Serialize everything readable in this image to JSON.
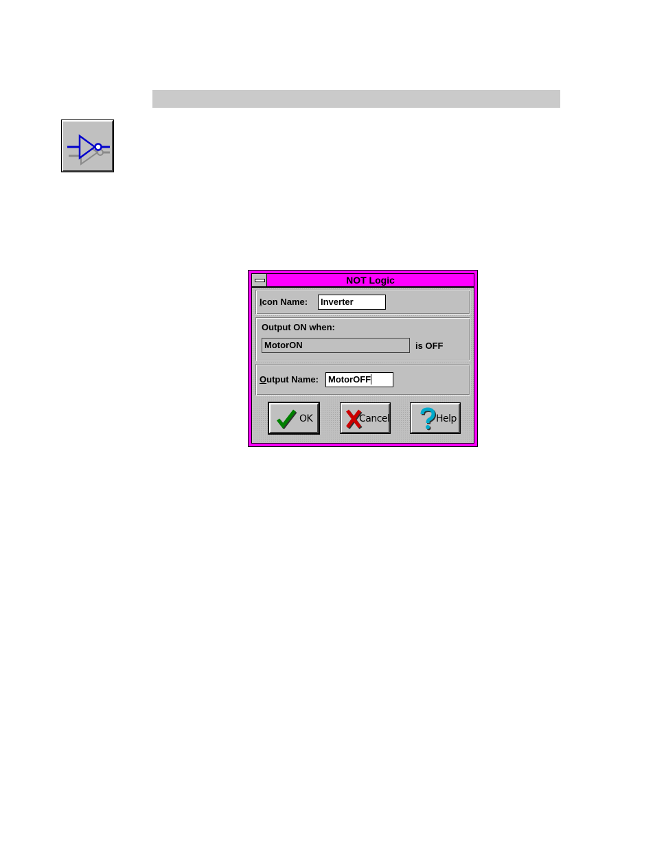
{
  "dialog": {
    "title": "NOT Logic",
    "icon_name_label_accel": "I",
    "icon_name_label_rest": "con Name:",
    "icon_name_value": "Inverter",
    "output_on_label": "Output ON when:",
    "input_value": "MotorON",
    "is_off_text": "is OFF",
    "output_name_label_accel": "O",
    "output_name_label_rest": "utput Name:",
    "output_name_value": "MotorOFF",
    "buttons": {
      "ok": "OK",
      "cancel": "Cancel",
      "help": "Help"
    }
  },
  "icons": {
    "tool": "not-gate-icon",
    "ok": "checkmark-icon",
    "cancel": "x-icon",
    "help": "question-icon"
  },
  "colors": {
    "dialog_frame": "#ff00ff",
    "gate": "#0000cc",
    "check": "#008000",
    "cancel_x": "#cc0000",
    "help_q": "#00aacc"
  }
}
